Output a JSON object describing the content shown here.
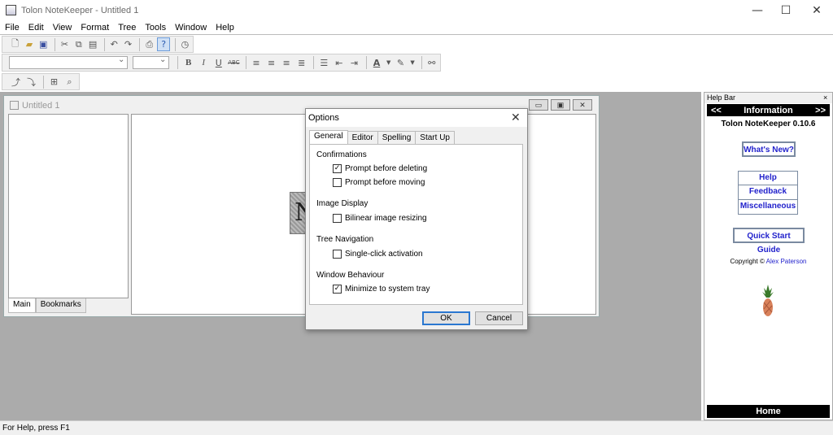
{
  "window": {
    "title": "Tolon NoteKeeper - Untitled 1",
    "minimize": "—",
    "maximize": "☐",
    "close": "✕"
  },
  "menu": [
    "File",
    "Edit",
    "View",
    "Format",
    "Tree",
    "Tools",
    "Window",
    "Help"
  ],
  "toolbar": {
    "bold": "B",
    "italic": "I",
    "underline": "U",
    "strike": "ABC",
    "font_color": "A"
  },
  "document": {
    "title": "Untitled 1",
    "image_letter": "N",
    "tabs": [
      "Main",
      "Bookmarks"
    ]
  },
  "dialog": {
    "title": "Options",
    "close": "✕",
    "tabs": [
      "General",
      "Editor",
      "Spelling",
      "Start Up"
    ],
    "groups": [
      {
        "label": "Confirmations",
        "items": [
          {
            "label": "Prompt before deleting",
            "checked": true
          },
          {
            "label": "Prompt before moving",
            "checked": false
          }
        ]
      },
      {
        "label": "Image Display",
        "items": [
          {
            "label": "Bilinear image resizing",
            "checked": false
          }
        ]
      },
      {
        "label": "Tree Navigation",
        "items": [
          {
            "label": "Single-click activation",
            "checked": false
          }
        ]
      },
      {
        "label": "Window Behaviour",
        "items": [
          {
            "label": "Minimize to system tray",
            "checked": true
          }
        ]
      }
    ],
    "ok": "OK",
    "cancel": "Cancel",
    "check_mark": "✓"
  },
  "helpbar": {
    "title": "Help Bar",
    "close": "×",
    "nav_prev": "<<",
    "nav_next": ">>",
    "header": "Information",
    "version": "Tolon NoteKeeper 0.10.6",
    "whats_new": "What's New?",
    "links": [
      "Help",
      "Feedback",
      "Miscellaneous"
    ],
    "quick_start": "Quick Start Guide",
    "copyright_prefix": "Copyright ©",
    "author": "Alex Paterson",
    "home": "Home"
  },
  "status": "For Help, press F1"
}
